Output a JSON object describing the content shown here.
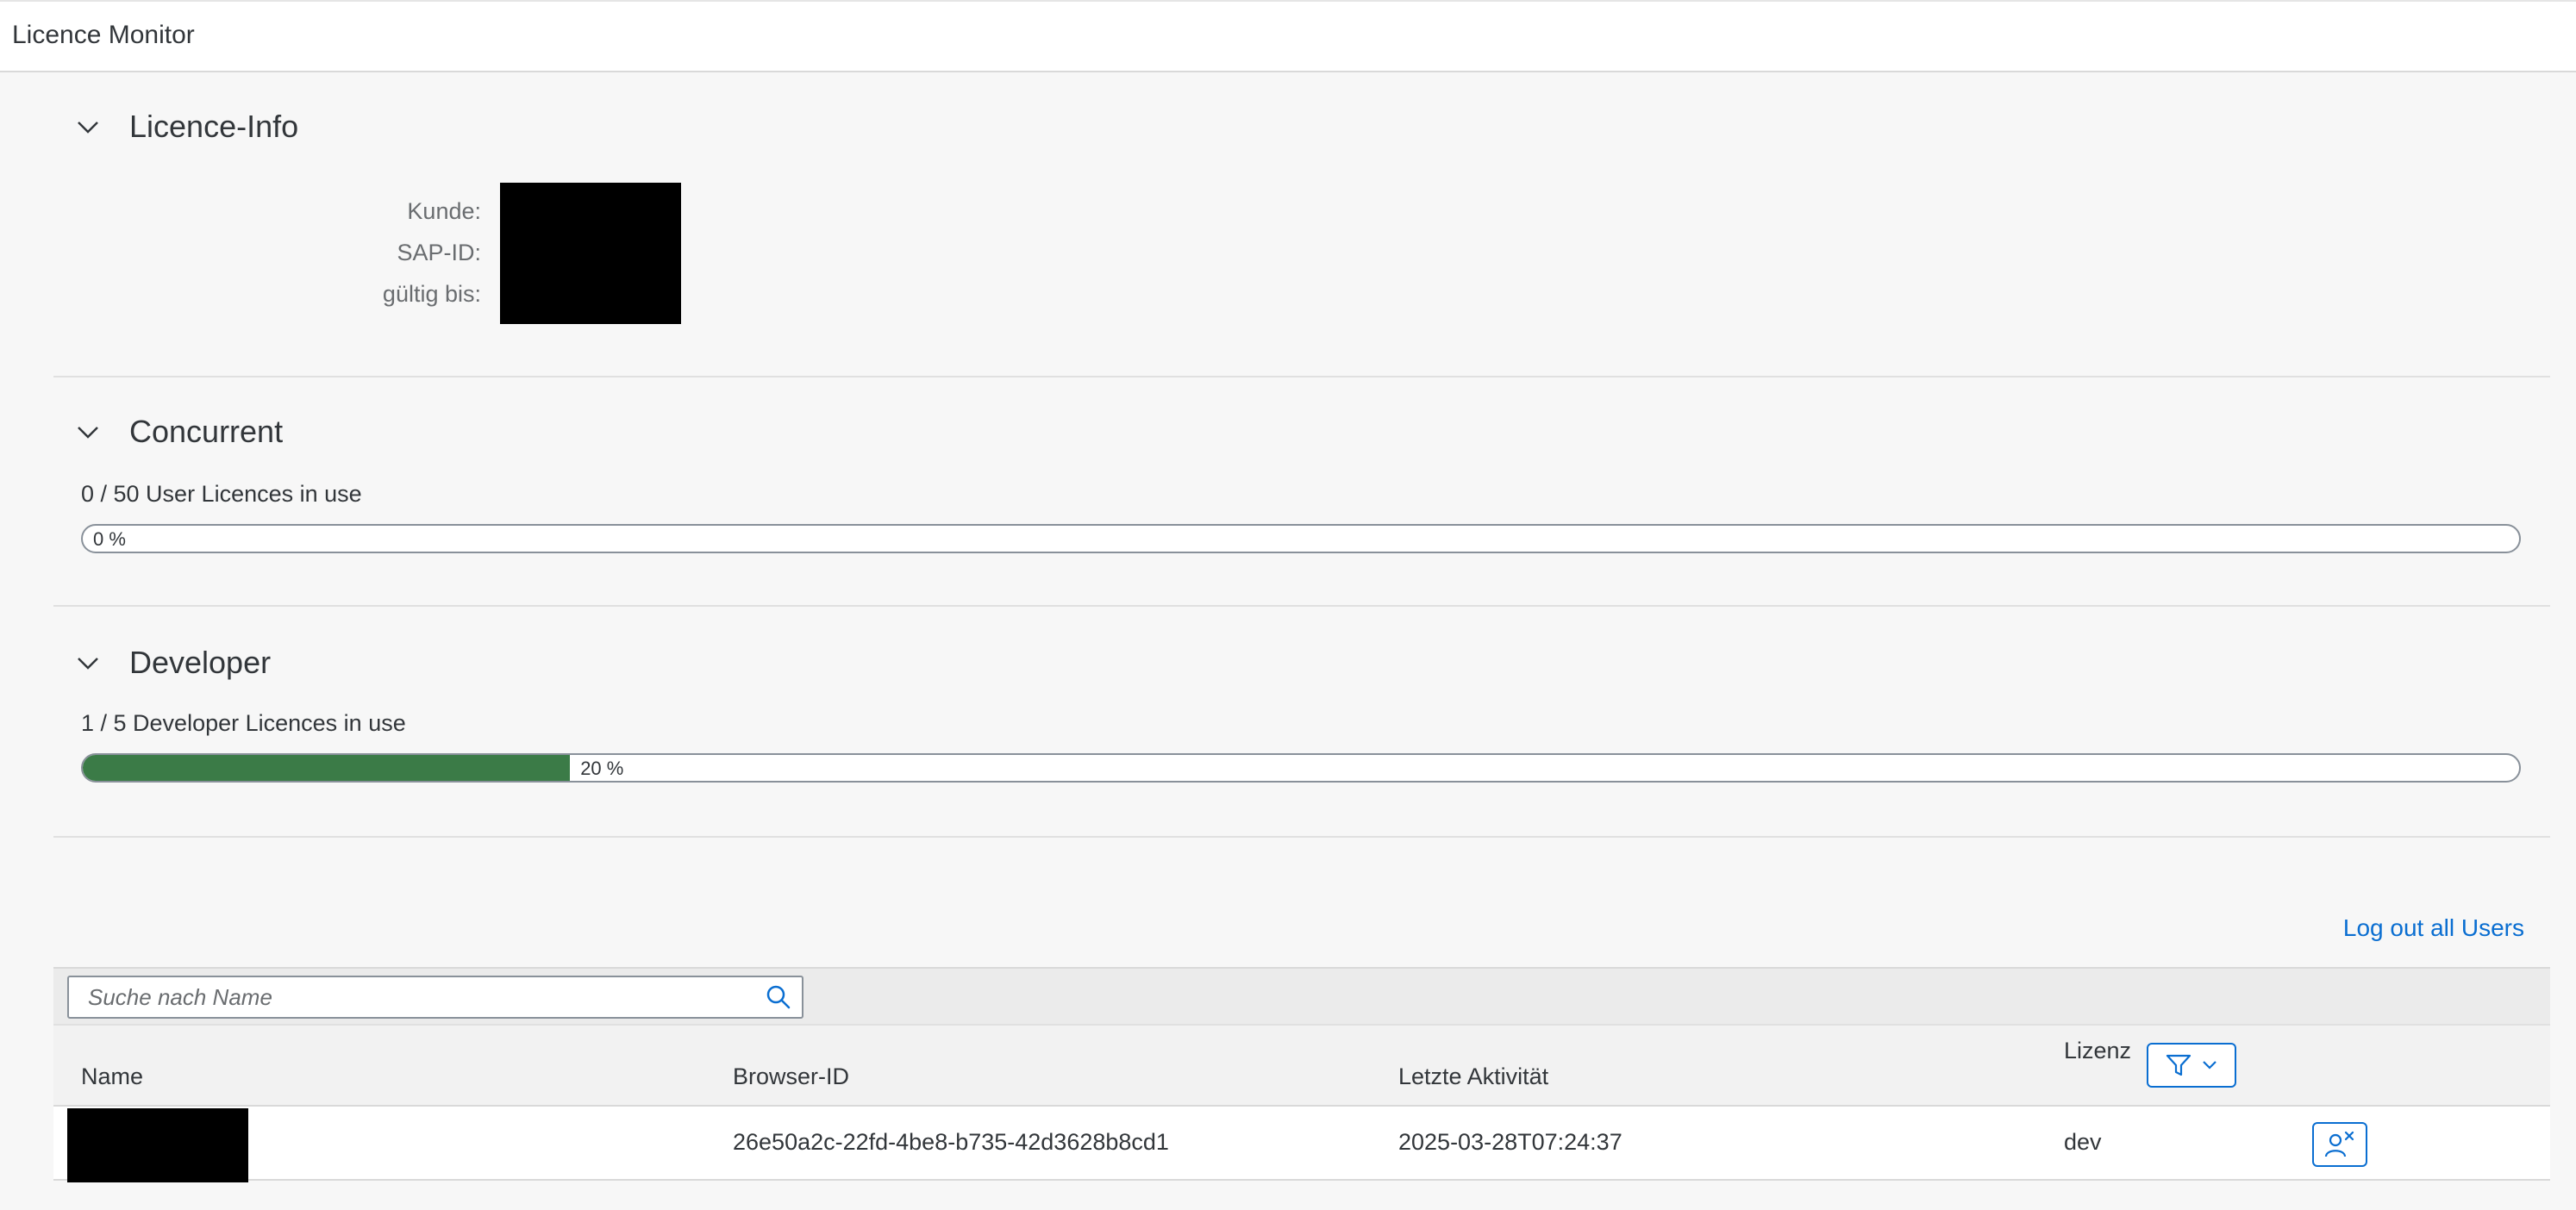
{
  "header": {
    "title": "Licence Monitor"
  },
  "licence_info": {
    "title": "Licence-Info",
    "fields": [
      {
        "label": "Kunde:"
      },
      {
        "label": "SAP-ID:"
      },
      {
        "label": "gültig bis:"
      }
    ]
  },
  "concurrent": {
    "title": "Concurrent",
    "usage_text": "0 / 50 User Licences in use",
    "progress_label": "0 %",
    "progress_percent": 0
  },
  "developer": {
    "title": "Developer",
    "usage_text": "1 / 5 Developer Licences in use",
    "progress_label": "20 %",
    "progress_percent": 20
  },
  "users_table": {
    "logout_all_label": "Log out all Users",
    "search_placeholder": "Suche nach Name",
    "columns": {
      "name": "Name",
      "browser_id": "Browser-ID",
      "last_activity": "Letzte Aktivität",
      "licence": "Lizenz"
    },
    "rows": [
      {
        "browser_id": "26e50a2c-22fd-4be8-b735-42d3628b8cd1",
        "last_activity": "2025-03-28T07:24:37",
        "licence": "dev"
      }
    ]
  },
  "colors": {
    "accent": "#0a6ed1",
    "progress_fill": "#3b7b47",
    "background": "#f7f7f7"
  },
  "icons": {
    "panel_toggle": "chevron-down-icon",
    "search": "search-icon",
    "filter": "filter-icon",
    "logout_user": "person-logout-icon"
  }
}
